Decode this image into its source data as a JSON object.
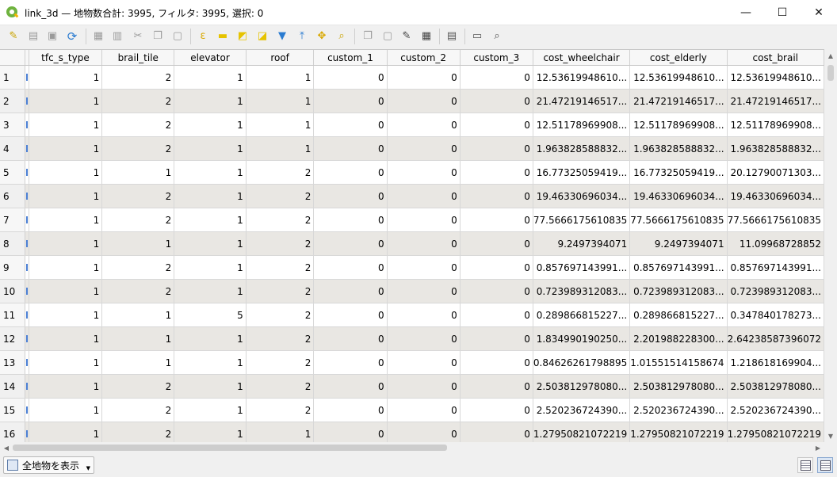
{
  "window": {
    "title": "link_3d — 地物数合計: 3995, フィルタ: 3995, 選択: 0",
    "minimize": "—",
    "maximize": "☐",
    "close": "✕"
  },
  "toolbar": {
    "icons": [
      "pencil-icon",
      "multi-edit-icon",
      "save-icon",
      "reload-icon",
      "add-feature-icon",
      "delete-icon",
      "cut-icon",
      "copy-icon",
      "paste-icon",
      "select-expression-icon",
      "select-all-icon",
      "invert-selection-icon",
      "deselect-icon",
      "filter-icon",
      "move-top-icon",
      "pan-icon",
      "zoom-icon",
      "copy-cells-icon",
      "paste-cells-icon",
      "field-calc-icon",
      "conditional-format-icon",
      "actions-icon",
      "dock-icon",
      "zoom-map-icon"
    ]
  },
  "table": {
    "columns": [
      "tfc_s_type",
      "brail_tile",
      "elevator",
      "roof",
      "custom_1",
      "custom_2",
      "custom_3",
      "cost_wheelchair",
      "cost_elderly",
      "cost_brail"
    ],
    "rows": [
      {
        "n": "1",
        "v": [
          "1",
          "2",
          "1",
          "1",
          "0",
          "0",
          "0",
          "12.53619948610...",
          "12.53619948610...",
          "12.53619948610..."
        ]
      },
      {
        "n": "2",
        "v": [
          "1",
          "2",
          "1",
          "1",
          "0",
          "0",
          "0",
          "21.47219146517...",
          "21.47219146517...",
          "21.47219146517..."
        ]
      },
      {
        "n": "3",
        "v": [
          "1",
          "2",
          "1",
          "1",
          "0",
          "0",
          "0",
          "12.51178969908...",
          "12.51178969908...",
          "12.51178969908..."
        ]
      },
      {
        "n": "4",
        "v": [
          "1",
          "2",
          "1",
          "1",
          "0",
          "0",
          "0",
          "1.963828588832...",
          "1.963828588832...",
          "1.963828588832..."
        ]
      },
      {
        "n": "5",
        "v": [
          "1",
          "1",
          "1",
          "2",
          "0",
          "0",
          "0",
          "16.77325059419...",
          "16.77325059419...",
          "20.12790071303..."
        ]
      },
      {
        "n": "6",
        "v": [
          "1",
          "2",
          "1",
          "2",
          "0",
          "0",
          "0",
          "19.46330696034...",
          "19.46330696034...",
          "19.46330696034..."
        ]
      },
      {
        "n": "7",
        "v": [
          "1",
          "2",
          "1",
          "2",
          "0",
          "0",
          "0",
          "77.5666175610835",
          "77.5666175610835",
          "77.5666175610835"
        ]
      },
      {
        "n": "8",
        "v": [
          "1",
          "1",
          "1",
          "2",
          "0",
          "0",
          "0",
          "9.2497394071",
          "9.2497394071",
          "11.09968728852"
        ]
      },
      {
        "n": "9",
        "v": [
          "1",
          "2",
          "1",
          "2",
          "0",
          "0",
          "0",
          "0.857697143991...",
          "0.857697143991...",
          "0.857697143991..."
        ]
      },
      {
        "n": "10",
        "v": [
          "1",
          "2",
          "1",
          "2",
          "0",
          "0",
          "0",
          "0.723989312083...",
          "0.723989312083...",
          "0.723989312083..."
        ]
      },
      {
        "n": "11",
        "v": [
          "1",
          "1",
          "5",
          "2",
          "0",
          "0",
          "0",
          "0.289866815227...",
          "0.289866815227...",
          "0.347840178273..."
        ]
      },
      {
        "n": "12",
        "v": [
          "1",
          "1",
          "1",
          "2",
          "0",
          "0",
          "0",
          "1.834990190250...",
          "2.201988228300...",
          "2.64238587396072"
        ]
      },
      {
        "n": "13",
        "v": [
          "1",
          "1",
          "1",
          "2",
          "0",
          "0",
          "0",
          "0.84626261798895",
          "1.01551514158674",
          "1.218618169904..."
        ]
      },
      {
        "n": "14",
        "v": [
          "1",
          "2",
          "1",
          "2",
          "0",
          "0",
          "0",
          "2.503812978080...",
          "2.503812978080...",
          "2.503812978080..."
        ]
      },
      {
        "n": "15",
        "v": [
          "1",
          "2",
          "1",
          "2",
          "0",
          "0",
          "0",
          "2.520236724390...",
          "2.520236724390...",
          "2.520236724390..."
        ]
      },
      {
        "n": "16",
        "v": [
          "1",
          "2",
          "1",
          "1",
          "0",
          "0",
          "0",
          "1.27950821072219",
          "1.27950821072219",
          "1.27950821072219"
        ]
      }
    ]
  },
  "statusbar": {
    "show_all_label": "全地物を表示"
  }
}
